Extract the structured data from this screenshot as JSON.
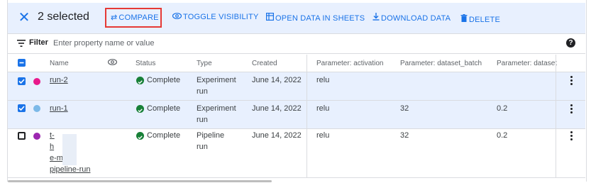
{
  "toolbar": {
    "selected_label": "2 selected",
    "compare": "COMPARE",
    "toggle_visibility": "TOGGLE VISIBILITY",
    "open_sheets": "OPEN DATA IN SHEETS",
    "download": "DOWNLOAD DATA",
    "delete": "DELETE"
  },
  "filter": {
    "label": "Filter",
    "placeholder": "Enter property name or value",
    "value": ""
  },
  "columns": {
    "name": "Name",
    "status": "Status",
    "type": "Type",
    "created": "Created",
    "param_activation": "Parameter: activation",
    "param_dataset_batch": "Parameter: dataset_batch",
    "param_dataset": "Parameter: dataset"
  },
  "rows": [
    {
      "name": "run-2",
      "checked": true,
      "dot_color": "#e8198b",
      "status": "Complete",
      "type_line1": "Experiment",
      "type_line2": "run",
      "created": "June 14, 2022",
      "activation": "relu",
      "dataset_batch": "",
      "dataset": ""
    },
    {
      "name": "run-1",
      "checked": true,
      "dot_color": "#7cb9e8",
      "status": "Complete",
      "type_line1": "Experiment",
      "type_line2": "run",
      "created": "June 14, 2022",
      "activation": "relu",
      "dataset_batch": "32",
      "dataset": "0.2"
    },
    {
      "name_line1": "t-",
      "name_line2": "h",
      "name_line3": "e-ment-",
      "name_line4": "pipeline-run",
      "checked": false,
      "dot_color": "#9c27b0",
      "status": "Complete",
      "type_line1": "Pipeline",
      "type_line2": "run",
      "created": "June 14, 2022",
      "activation": "relu",
      "dataset_batch": "32",
      "dataset": "0.2"
    }
  ],
  "colors": {
    "accent": "#1a73e8",
    "selected_bg": "#e8f0fe",
    "status_ok": "#188038",
    "highlight_box": "#e53935"
  }
}
